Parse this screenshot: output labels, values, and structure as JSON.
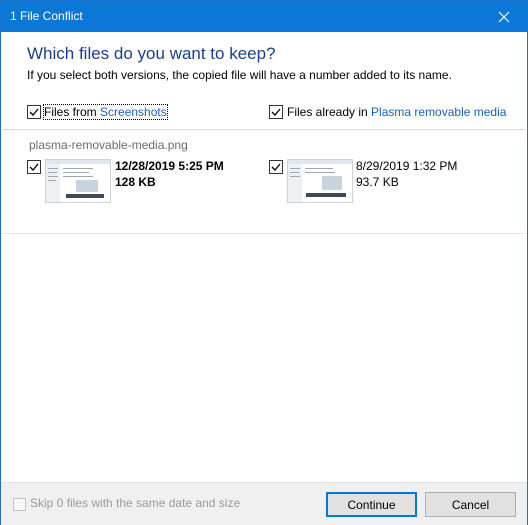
{
  "window": {
    "title": "1 File Conflict",
    "close_icon": "close-icon"
  },
  "dialog": {
    "heading": "Which files do you want to keep?",
    "subheading": "If you select both versions, the copied file will have a number added to its name."
  },
  "source": {
    "prefix": "Files from ",
    "location": "Screenshots",
    "checked": true
  },
  "destination": {
    "prefix": "Files already in ",
    "location": "Plasma removable media",
    "checked": true
  },
  "conflict": {
    "filename": "plasma-removable-media.png",
    "source_file": {
      "date": "12/28/2019 5:25 PM",
      "size": "128 KB",
      "checked": true
    },
    "destination_file": {
      "date": "8/29/2019 1:32 PM",
      "size": "93.7 KB",
      "checked": true
    }
  },
  "footer": {
    "skip_label": "Skip 0 files with the same date and size",
    "continue_label": "Continue",
    "cancel_label": "Cancel"
  },
  "colors": {
    "titlebar": "#0b78d7",
    "heading": "#1a3f8f",
    "link": "#1a62b8"
  }
}
